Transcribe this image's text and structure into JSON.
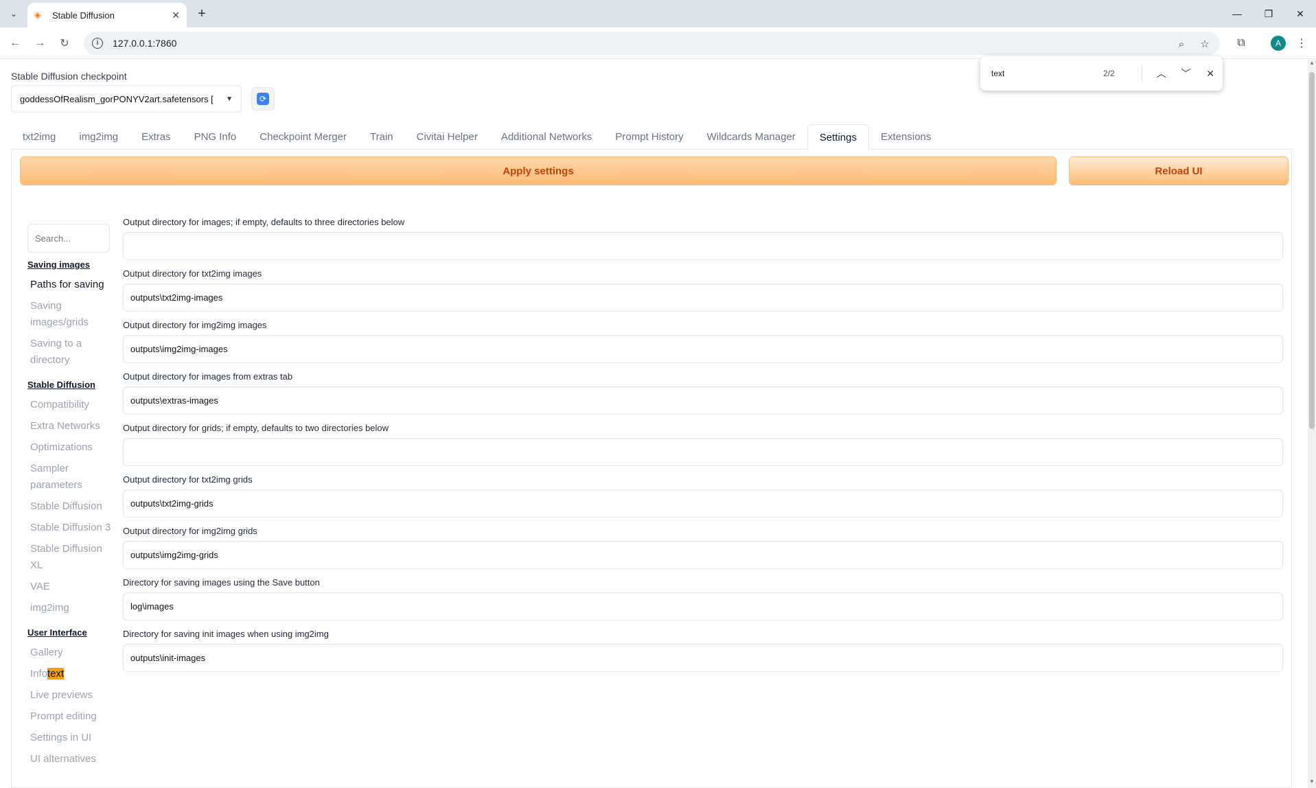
{
  "browser": {
    "tab_title": "Stable Diffusion",
    "url": "127.0.0.1:7860",
    "avatar_letter": "A"
  },
  "find": {
    "query": "text",
    "count": "2/2"
  },
  "checkpoint": {
    "label": "Stable Diffusion checkpoint",
    "value": "goddessOfRealism_gorPONYV2art.safetensors ["
  },
  "tabs": [
    "txt2img",
    "img2img",
    "Extras",
    "PNG Info",
    "Checkpoint Merger",
    "Train",
    "Civitai Helper",
    "Additional Networks",
    "Prompt History",
    "Wildcards Manager",
    "Settings",
    "Extensions"
  ],
  "active_tab": "Settings",
  "buttons": {
    "apply": "Apply settings",
    "reload": "Reload UI"
  },
  "sidebar": {
    "search_placeholder": "Search...",
    "sections": [
      {
        "title": "Saving images",
        "items": [
          "Paths for saving",
          "Saving images/grids",
          "Saving to a directory"
        ]
      },
      {
        "title": "Stable Diffusion",
        "items": [
          "Compatibility",
          "Extra Networks",
          "Optimizations",
          "Sampler parameters",
          "Stable Diffusion",
          "Stable Diffusion 3",
          "Stable Diffusion XL",
          "VAE",
          "img2img"
        ]
      },
      {
        "title": "User Interface",
        "items": [
          "Gallery",
          "Info",
          "Live previews",
          "Prompt editing",
          "Settings in UI",
          "UI alternatives"
        ]
      }
    ],
    "current_item": "Paths for saving",
    "highlight_suffix": "text"
  },
  "fields": [
    {
      "label": "Output directory for images; if empty, defaults to three directories below",
      "value": ""
    },
    {
      "label": "Output directory for txt2img images",
      "value": "outputs\\txt2img-images"
    },
    {
      "label": "Output directory for img2img images",
      "value": "outputs\\img2img-images"
    },
    {
      "label": "Output directory for images from extras tab",
      "value": "outputs\\extras-images"
    },
    {
      "label": "Output directory for grids; if empty, defaults to two directories below",
      "value": ""
    },
    {
      "label": "Output directory for txt2img grids",
      "value": "outputs\\txt2img-grids"
    },
    {
      "label": "Output directory for img2img grids",
      "value": "outputs\\img2img-grids"
    },
    {
      "label": "Directory for saving images using the Save button",
      "value": "log\\images"
    },
    {
      "label": "Directory for saving init images when using img2img",
      "value": "outputs\\init-images"
    }
  ],
  "colors": {
    "accent_orange": "#fdba74",
    "accent_text": "#c2410c",
    "find_highlight": "#f59e0b"
  }
}
